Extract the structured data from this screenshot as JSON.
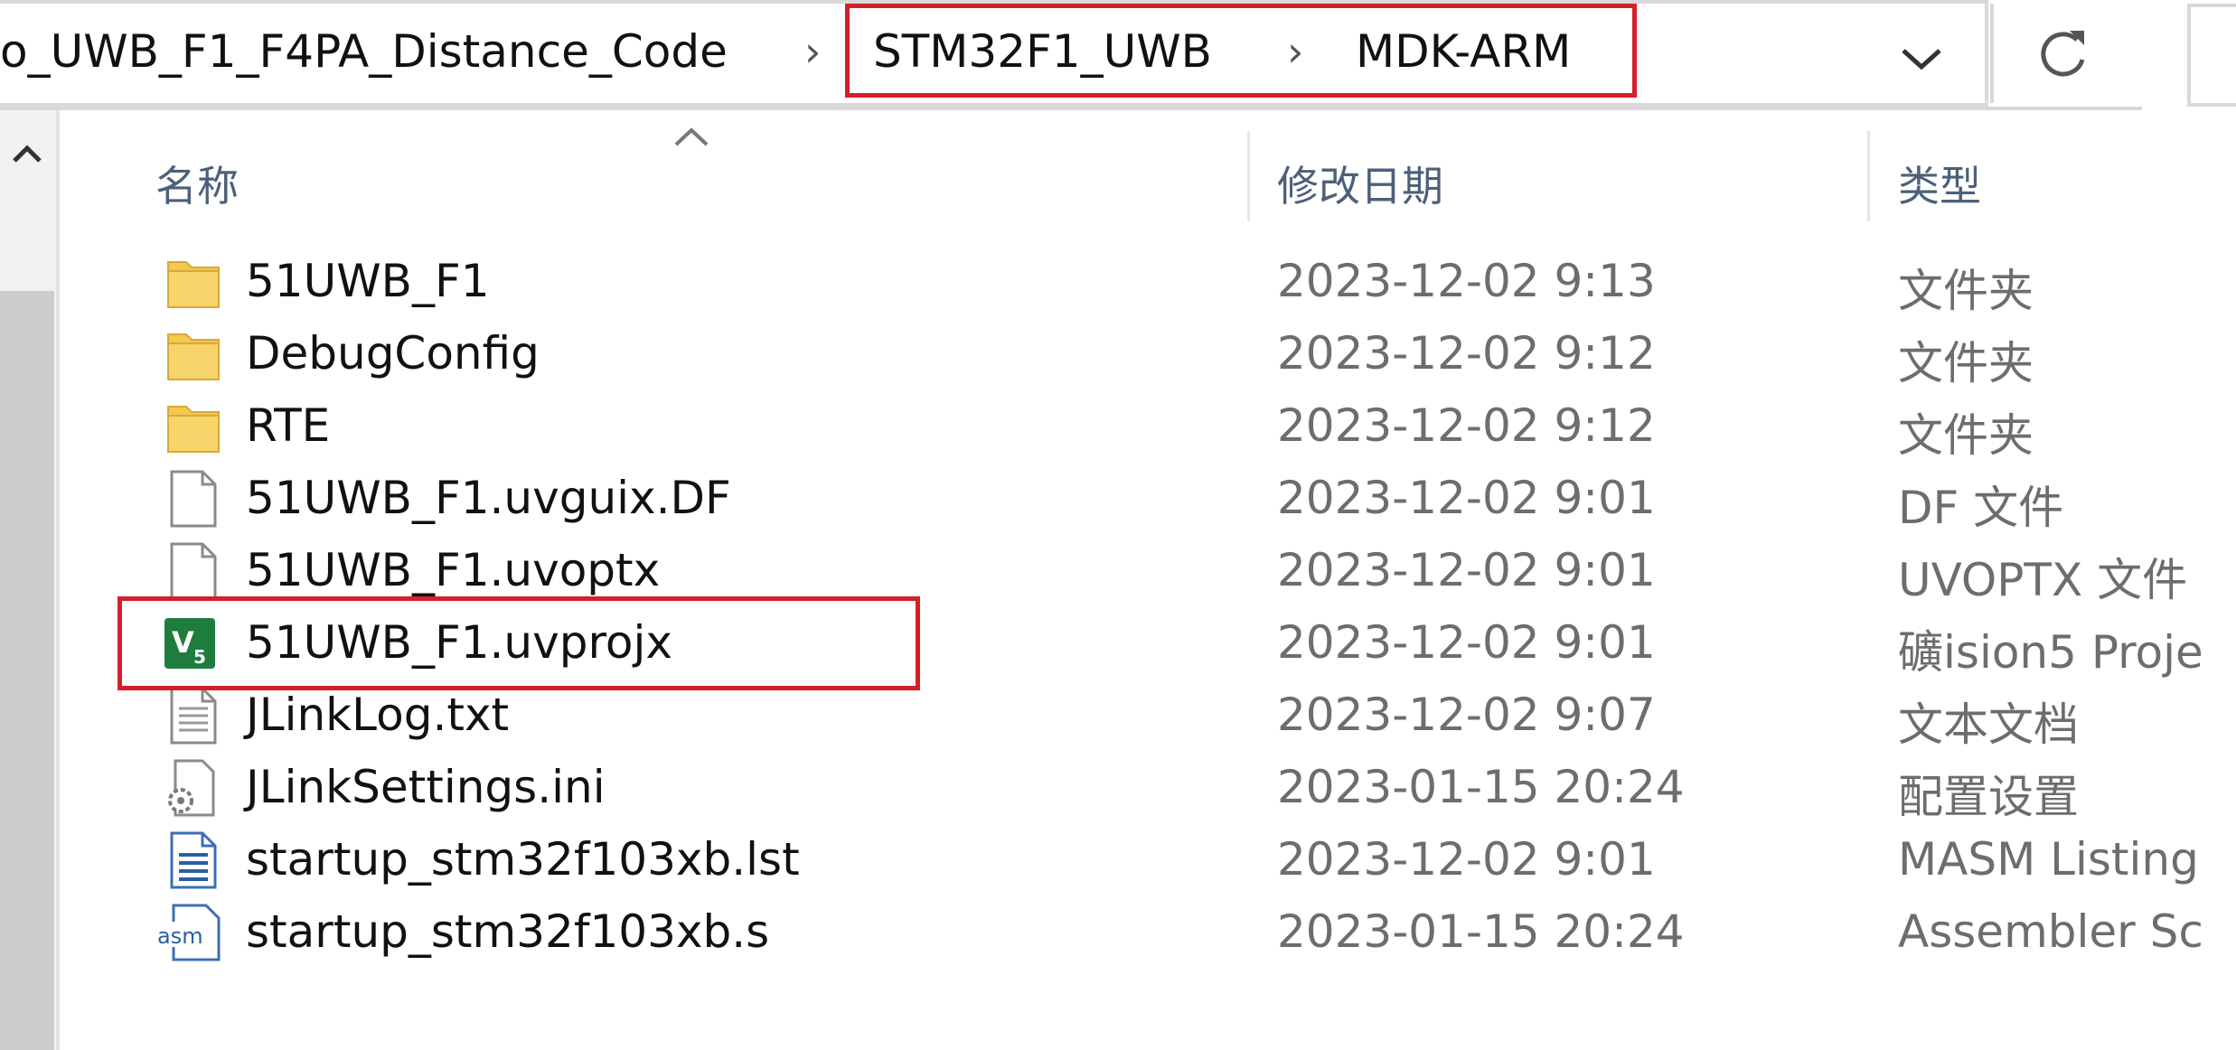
{
  "address_bar": {
    "crumbs": [
      "o_UWB_F1_F4PA_Distance_Code",
      "STM32F1_UWB",
      "MDK-ARM"
    ],
    "separator": "›",
    "dropdown_icon": "chevron-down-icon",
    "refresh_icon": "refresh-icon"
  },
  "columns": {
    "name": "名称",
    "modified": "修改日期",
    "type": "类型"
  },
  "files": [
    {
      "name": "51UWB_F1",
      "modified": "2023-12-02 9:13",
      "type": "文件夹",
      "icon": "folder-icon"
    },
    {
      "name": "DebugConfig",
      "modified": "2023-12-02 9:12",
      "type": "文件夹",
      "icon": "folder-icon"
    },
    {
      "name": "RTE",
      "modified": "2023-12-02 9:12",
      "type": "文件夹",
      "icon": "folder-icon"
    },
    {
      "name": "51UWB_F1.uvguix.DF",
      "modified": "2023-12-02 9:01",
      "type": "DF 文件",
      "icon": "file-icon"
    },
    {
      "name": "51UWB_F1.uvoptx",
      "modified": "2023-12-02 9:01",
      "type": "UVOPTX 文件",
      "icon": "file-icon"
    },
    {
      "name": "51UWB_F1.uvprojx",
      "modified": "2023-12-02 9:01",
      "type": "礦ision5 Proje",
      "icon": "keil-project-icon"
    },
    {
      "name": "JLinkLog.txt",
      "modified": "2023-12-02 9:07",
      "type": "文本文档",
      "icon": "text-file-icon"
    },
    {
      "name": "JLinkSettings.ini",
      "modified": "2023-01-15 20:24",
      "type": "配置设置",
      "icon": "settings-file-icon"
    },
    {
      "name": "startup_stm32f103xb.lst",
      "modified": "2023-12-02 9:01",
      "type": "MASM Listing",
      "icon": "listing-file-icon"
    },
    {
      "name": "startup_stm32f103xb.s",
      "modified": "2023-01-15 20:24",
      "type": "Assembler Sc",
      "icon": "asm-file-icon"
    }
  ],
  "highlight_color": "#d51f2a",
  "folder_color": "#f5c74f"
}
